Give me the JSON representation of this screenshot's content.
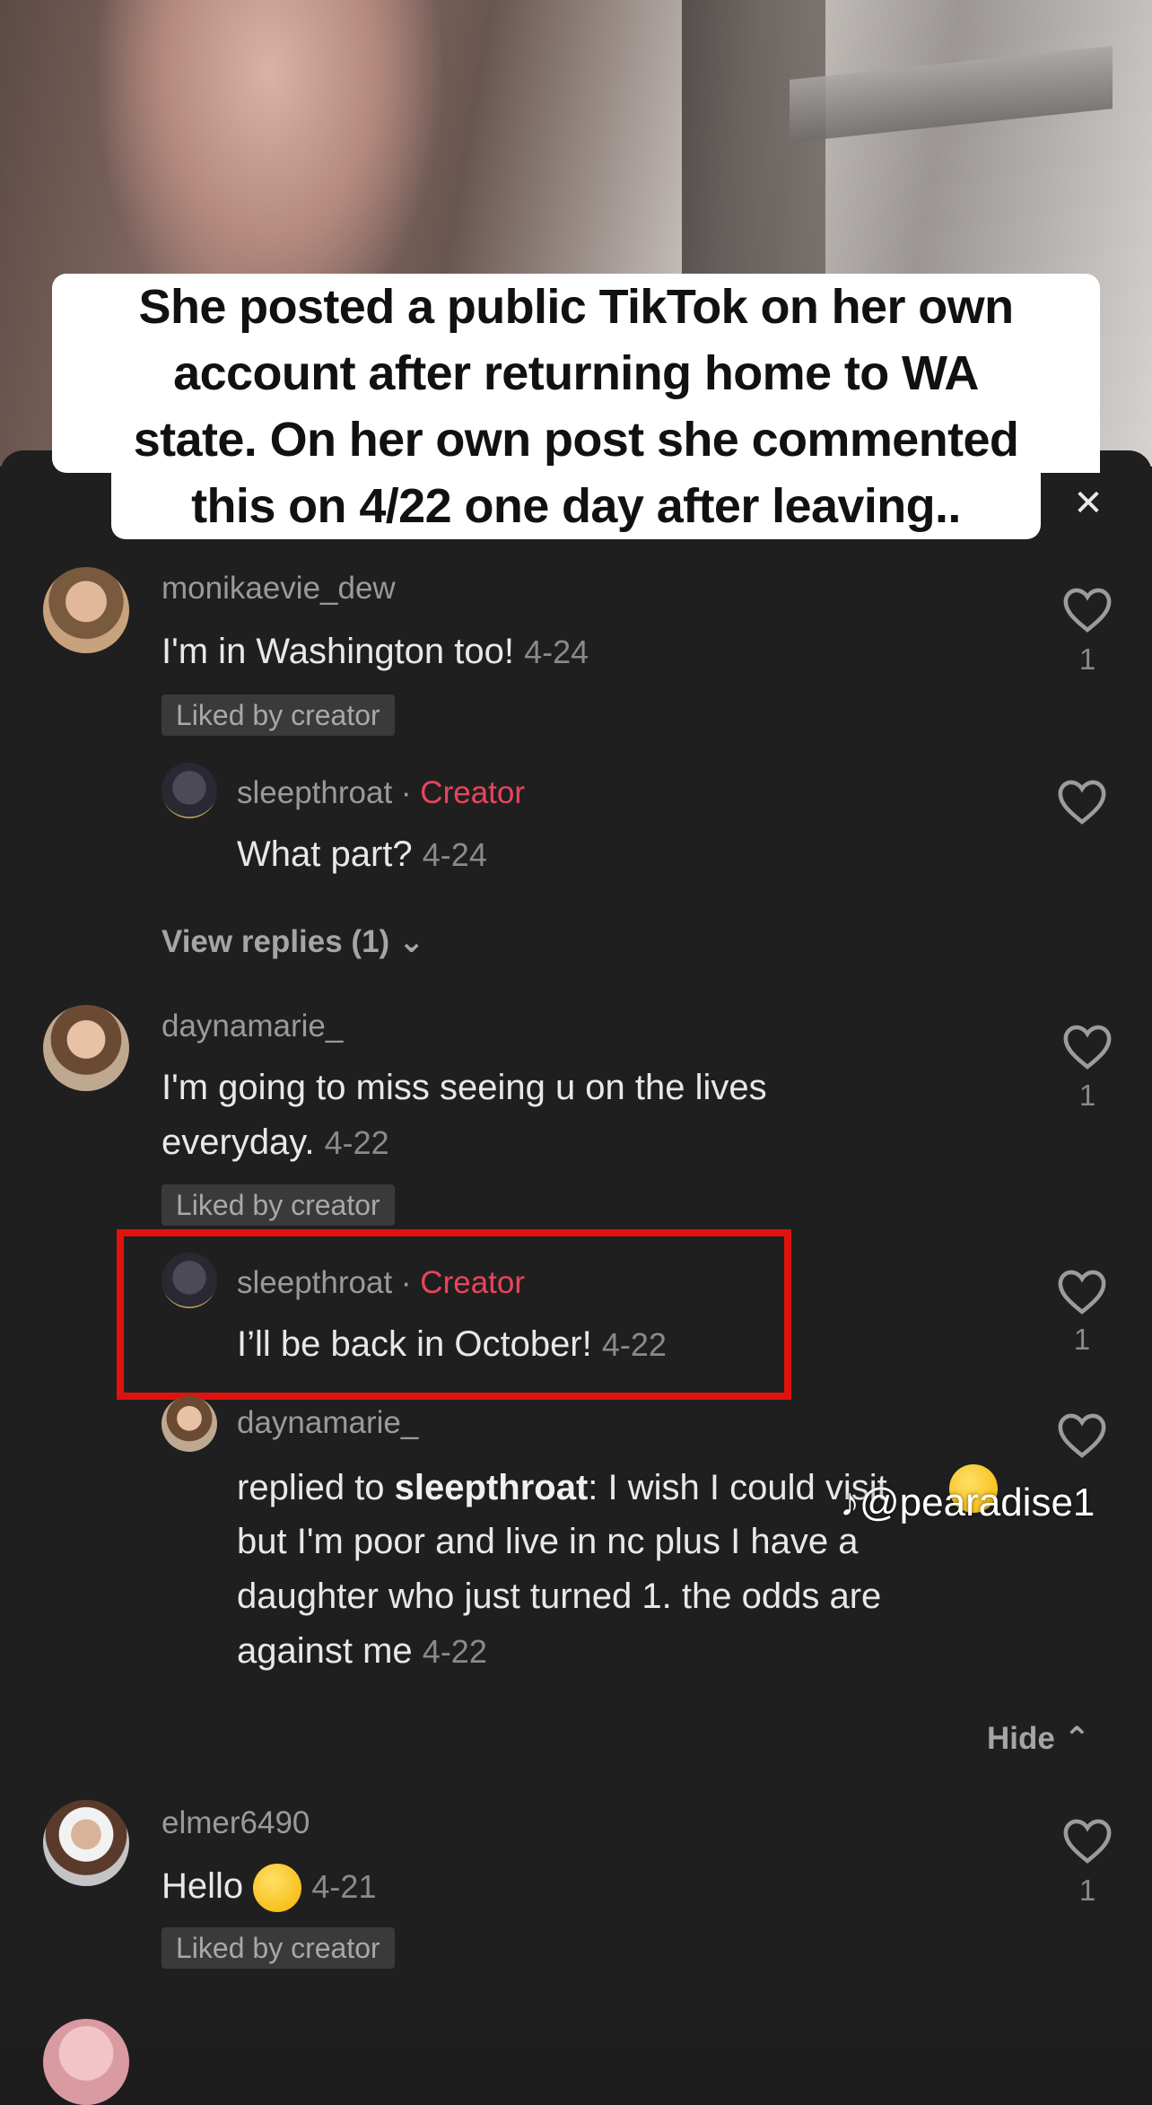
{
  "caption": {
    "lines": [
      "She posted a public TikTok on her own",
      "account after returning home to WA",
      "state. On her own post she commented",
      "this on 4/22 one day after leaving.."
    ]
  },
  "close_icon": "✕",
  "comments": [
    {
      "username": "monikaevie_dew",
      "text": "I'm in Washington too!",
      "date": "4-24",
      "liked_by_creator": "Liked by creator",
      "likes": "1"
    },
    {
      "username": "sleepthroat",
      "separator": "·",
      "badge": "Creator",
      "text": "What part?",
      "date": "4-24"
    },
    {
      "view_replies": "View replies (1)"
    },
    {
      "username": "daynamarie_",
      "text_line1": "I'm going to miss seeing u on the lives",
      "text_line2": "everyday.",
      "date": "4-22",
      "liked_by_creator": "Liked by creator",
      "likes": "1"
    },
    {
      "username": "sleepthroat",
      "separator": "·",
      "badge": "Creator",
      "text": "I’ll be back in October!",
      "date": "4-22",
      "likes": "1"
    },
    {
      "username": "daynamarie_",
      "replied_prefix": "replied to ",
      "replied_user": "sleepthroat",
      "line1": ": I wish I could visit",
      "line2": "but I'm poor and live in nc plus I have a",
      "line3": "daughter who just turned 1. the odds are",
      "line4": "against me",
      "date": "4-22"
    },
    {
      "hide": "Hide"
    },
    {
      "username": "elmer6490",
      "text": "Hello",
      "date": "4-21",
      "liked_by_creator": "Liked by creator",
      "likes": "1"
    }
  ],
  "watermark": "@pearadise1",
  "colors": {
    "background": "#1f1f1f",
    "creator_badge": "#e8455c",
    "highlight_box": "#e0120d"
  }
}
